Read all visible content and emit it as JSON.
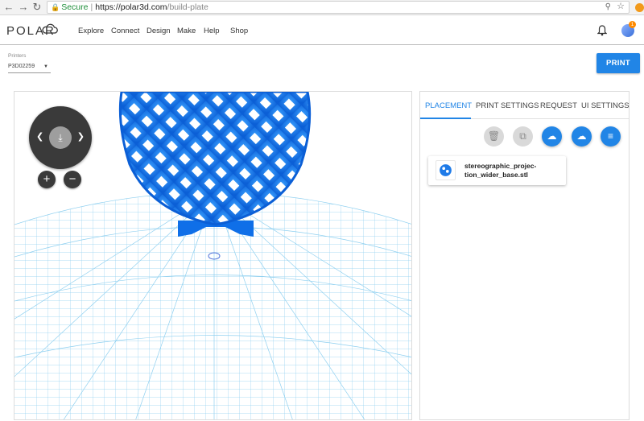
{
  "browser": {
    "secure_label": "Secure",
    "separator": "|",
    "url_host": "https://polar3d.com",
    "url_path": "/build-plate",
    "back_icon": "back-arrow-icon",
    "forward_icon": "forward-arrow-icon",
    "reload_icon": "reload-icon"
  },
  "app": {
    "logo_text": "POLAR",
    "menu": [
      "Explore",
      "Connect",
      "Design",
      "Make",
      "Help",
      "Shop"
    ],
    "notification_count": "1",
    "accent_color": "#2185e6"
  },
  "printer": {
    "label": "Printers",
    "selected": "P3D02259"
  },
  "print_button": "PRINT",
  "panel": {
    "tabs": [
      "PLACEMENT",
      "PRINT SETTINGS",
      "REQUEST",
      "UI SETTINGS"
    ],
    "active_tab": "PLACEMENT",
    "file_name": "stereographic_projec-tion_wider_base.stl"
  }
}
